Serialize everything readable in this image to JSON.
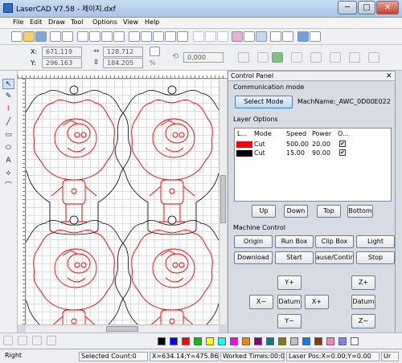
{
  "window": {
    "title": "LaserCAD V7.58 - 제이지.dxf",
    "min": "─",
    "max": "□",
    "close": "✕"
  },
  "menu": [
    "File",
    "Edit",
    "Draw",
    "Tool",
    "Options",
    "View",
    "Help"
  ],
  "coords": {
    "x_label": "X:",
    "x_value": "671.119",
    "y_label": "Y:",
    "y_value": "296.163",
    "w_value": "128.712",
    "h_value": "184.205",
    "angle_value": "0,000",
    "percent": "%"
  },
  "control_panel": {
    "title": "Control Panel",
    "comm_section": "Communication mode",
    "select_mode": "Select Mode",
    "mach_name": "MachName:_AWC_0D00E022",
    "layer_section": "Layer Options",
    "columns": [
      "L...",
      "Mode",
      "Speed",
      "Power",
      "O..."
    ],
    "layers": [
      {
        "color": "#ff0000",
        "mode": "Cut",
        "speed": "500.00",
        "power": "20.00",
        "output": "✔"
      },
      {
        "color": "#000000",
        "mode": "Cut",
        "speed": "15.00",
        "power": "90.00",
        "output": "✔"
      }
    ],
    "order_buttons": [
      "Up",
      "Down",
      "Top",
      "Bottom"
    ],
    "machine_section": "Machine Control",
    "machine_buttons": [
      "Origin",
      "Run Box",
      "Clip Box",
      "Light",
      "Download",
      "Start",
      "ause/Contin",
      "Stop"
    ],
    "jog": {
      "y_plus": "Y+",
      "x_minus": "X−",
      "datum": "Datum",
      "x_plus": "X+",
      "y_minus": "Y−",
      "z_plus": "Z+",
      "z_datum": "Datum",
      "z_minus": "Z−"
    }
  },
  "left_tools": [
    "↖",
    "✎",
    "⌇",
    "╱",
    "▭",
    "⬭",
    "A",
    "⟡",
    "⌒"
  ],
  "palette": [
    "#000000",
    "#0000ff",
    "#ff0000",
    "#00c000",
    "#ffff00",
    "#00ffff",
    "#ff00ff",
    "#ff8000",
    "#800080",
    "#008080",
    "#808000",
    "#c0c0c0",
    "#0080ff",
    "#804000",
    "#ff80c0",
    "#8080ff",
    "#ffffff"
  ],
  "status": {
    "mode": "Right",
    "selected": "Selected Count:0",
    "pos": "X=634.14;Y=475.86",
    "worked": "Worked Times:00:0(",
    "laser": "Laser Pos:X=0.00;Y=0.00",
    "unit": "Ur"
  }
}
